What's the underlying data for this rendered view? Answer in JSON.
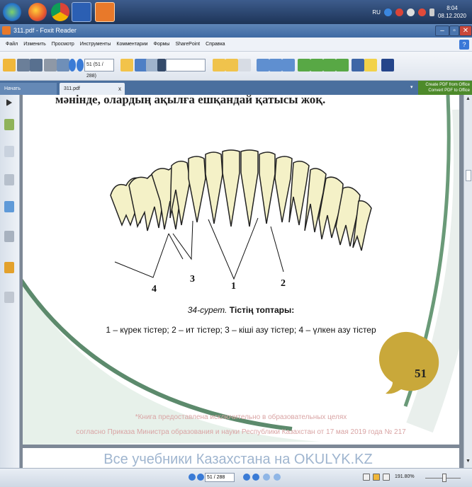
{
  "taskbar": {
    "tray": {
      "lang": "RU",
      "time": "8:04",
      "date": "08.12.2020"
    }
  },
  "window": {
    "title": "311.pdf - Foxit Reader"
  },
  "menu": {
    "items": [
      "Файл",
      "Изменить",
      "Просмотр",
      "Инструменты",
      "Комментарии",
      "Формы",
      "SharePoint",
      "Справка"
    ]
  },
  "toolbar": {
    "page_field": "51 (51 / 288)"
  },
  "tabs": {
    "home": "Начать",
    "doc": "311.pdf",
    "close": "x",
    "promo_line1": "Create PDF from Office",
    "promo_line2": "Convert PDF to Office"
  },
  "document": {
    "top_line": "мәнінде, олардың ақылға ешқандай қатысы жоқ.",
    "figure_labels": [
      "1",
      "2",
      "3",
      "4"
    ],
    "caption_prefix": "34-сурет.",
    "caption_title": "Тістің топтары:",
    "caption_body": "1 – күрек тістер; 2 – ит тістер; 3 – кіші азу тістер; 4 – үлкен азу тістер",
    "page_number": "51",
    "watermark_line1": "*Книга предоставлена исключительно в образовательных целях",
    "watermark_line2": "согласно Приказа Министра образования и науки Республики Казахстан от 17 мая 2019 года № 217",
    "footer_banner": "Все учебники Казахстана на OKULYK.KZ"
  },
  "statusbar": {
    "page_field": "51 / 288",
    "zoom": "191.80%"
  },
  "colors": {
    "accent": "#3a7bd6",
    "tooth_fill": "#f4f1c7",
    "page_badge": "#c9a83a",
    "arc_green": "#6a9a78"
  }
}
